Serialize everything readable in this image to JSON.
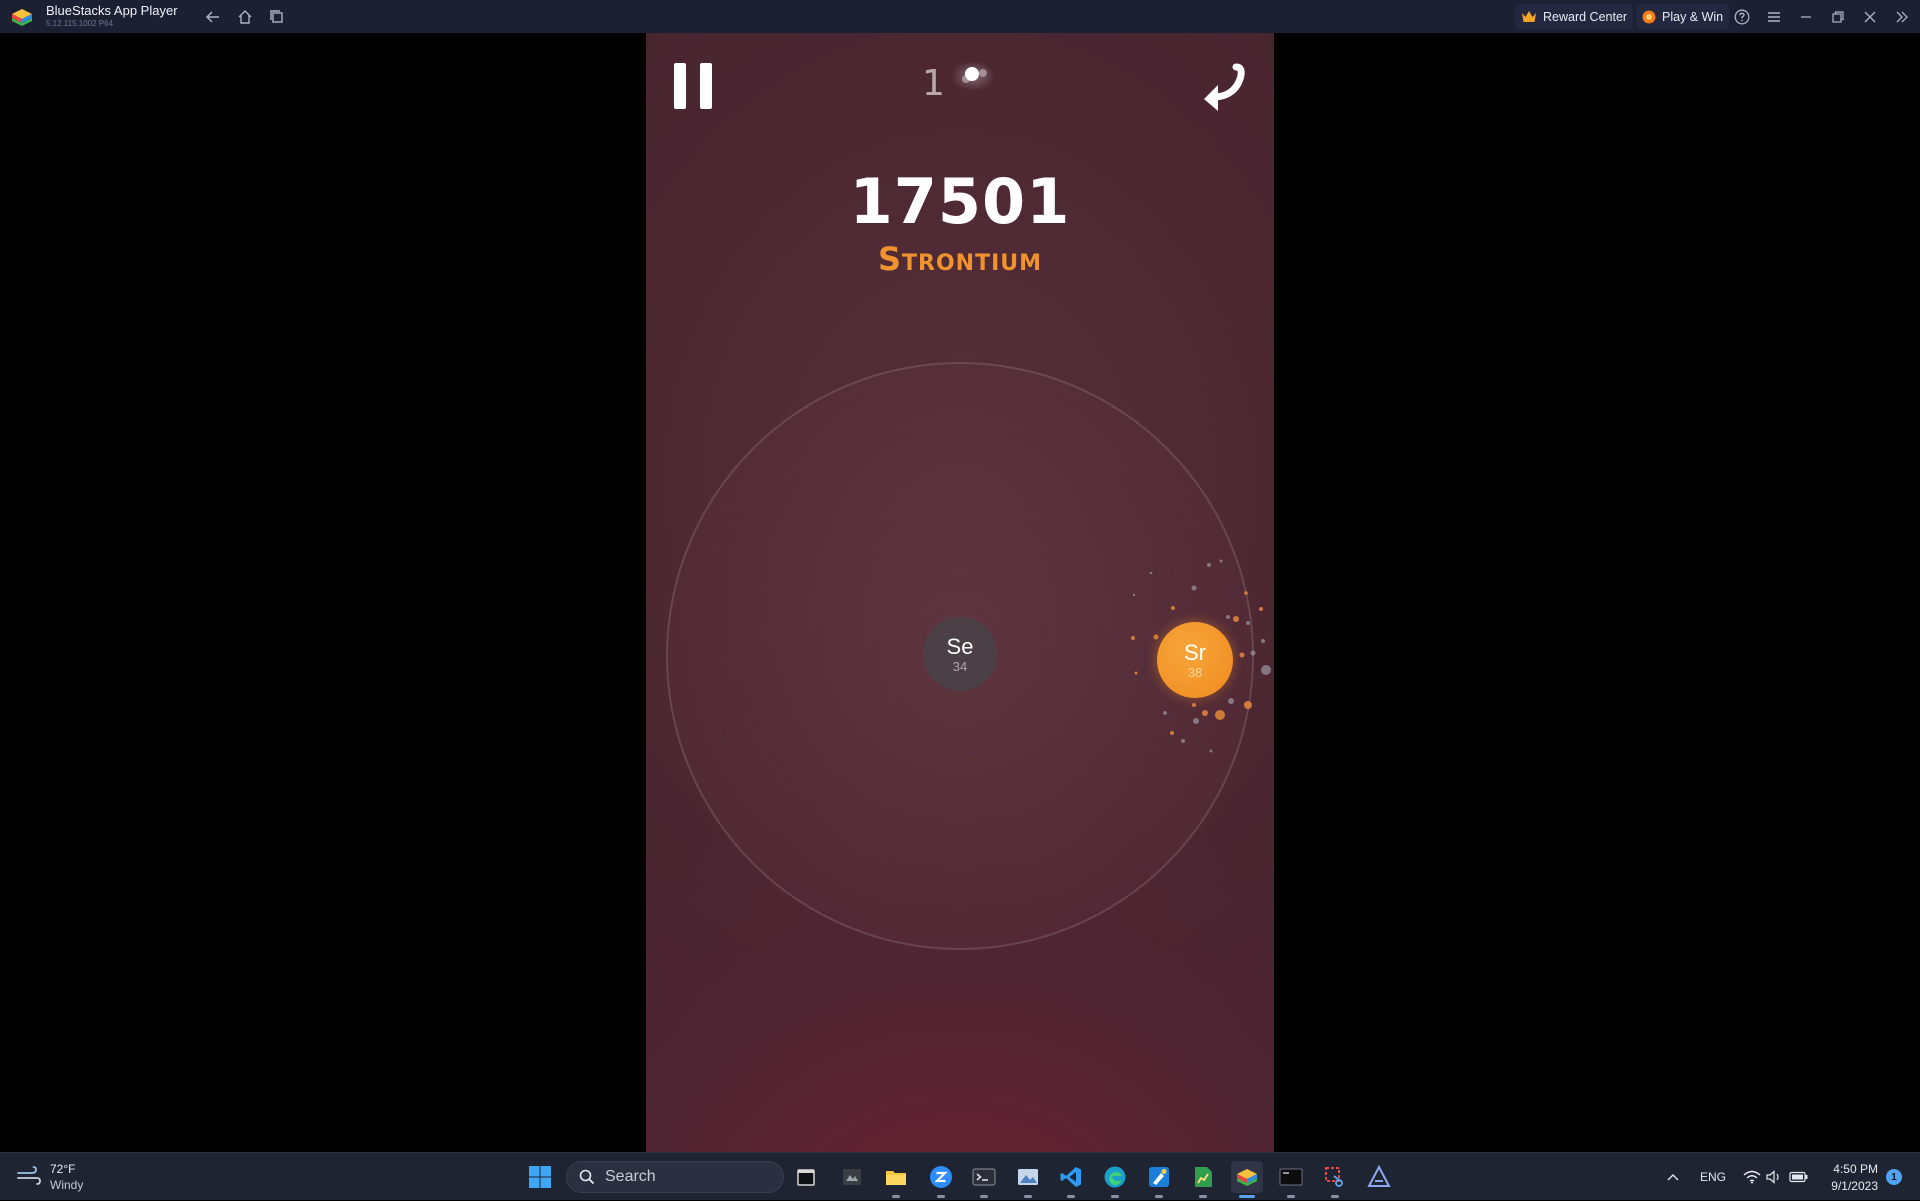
{
  "titlebar": {
    "app_name": "BlueStacks App Player",
    "app_version": "5.12.115.1002  P64",
    "reward_center_label": "Reward Center",
    "play_win_label": "Play & Win"
  },
  "game": {
    "counter": "1",
    "score": "17501",
    "element_name": "Strontium",
    "atoms": [
      {
        "symbol": "Se",
        "number": "34",
        "color": "#4a4045"
      },
      {
        "symbol": "Sr",
        "number": "38",
        "color": "#f29628"
      }
    ],
    "accent_color": "#f0922d"
  },
  "taskbar": {
    "weather_temp": "72°F",
    "weather_desc": "Windy",
    "search_placeholder": "Search",
    "language": "ENG",
    "time": "4:50 PM",
    "date": "9/1/2023",
    "notification_count": "1",
    "apps": [
      "file-explorer-icon",
      "zoom-icon",
      "terminal-icon",
      "vscode-icon",
      "edge-icon",
      "bluestacks-icon"
    ]
  }
}
